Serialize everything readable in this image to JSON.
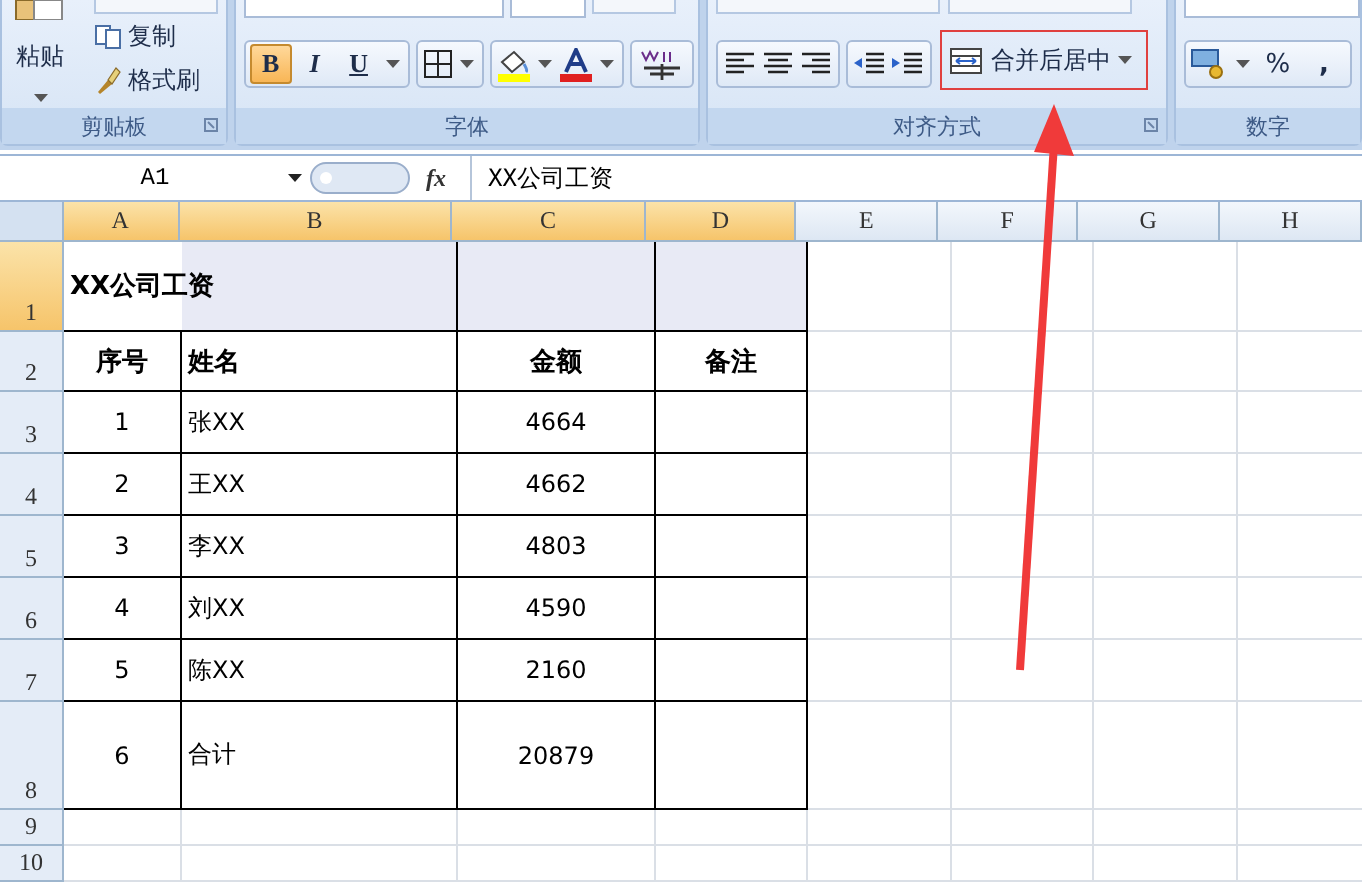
{
  "ribbon": {
    "clipboard": {
      "paste": "粘贴",
      "copy": "复制",
      "format_painter": "格式刷",
      "label": "剪贴板"
    },
    "font": {
      "label": "字体",
      "styles": [
        {
          "label": "B",
          "selected": true
        },
        {
          "label": "I",
          "selected": false
        },
        {
          "label": "U",
          "selected": false
        }
      ]
    },
    "alignment": {
      "label": "对齐方式",
      "merge": {
        "label": "合并后居中",
        "highlighted": true
      }
    },
    "number": {
      "label": "数字",
      "percent": "%",
      "comma": ","
    }
  },
  "formula_bar": {
    "name_box": "A1",
    "fx": "fx",
    "content": "XX公司工资"
  },
  "sheet": {
    "columns": [
      {
        "label": "A",
        "selected": true
      },
      {
        "label": "B",
        "selected": true
      },
      {
        "label": "C",
        "selected": true
      },
      {
        "label": "D",
        "selected": true
      },
      {
        "label": "E",
        "selected": false
      },
      {
        "label": "F",
        "selected": false
      },
      {
        "label": "G",
        "selected": false
      },
      {
        "label": "H",
        "selected": false
      }
    ],
    "rows": [
      {
        "label": "1",
        "kind": "title",
        "selected": true,
        "cells": [
          {
            "text": "XX公司工资",
            "selected": true,
            "active": true
          },
          {
            "selected": true
          },
          {
            "selected": true
          }
        ]
      },
      {
        "label": "2",
        "kind": "header",
        "selected": false,
        "cells": [
          {
            "text": "序号"
          },
          {
            "text": "姓名"
          },
          {
            "text": "金额"
          },
          {
            "text": "备注"
          }
        ]
      },
      {
        "label": "3",
        "kind": "data",
        "selected": false,
        "cells": [
          {
            "text": "1"
          },
          {
            "text": "张XX"
          },
          {
            "text": "4664"
          },
          {}
        ]
      },
      {
        "label": "4",
        "kind": "data",
        "selected": false,
        "cells": [
          {
            "text": "2"
          },
          {
            "text": "王XX"
          },
          {
            "text": "4662"
          },
          {}
        ]
      },
      {
        "label": "5",
        "kind": "data",
        "selected": false,
        "cells": [
          {
            "text": "3"
          },
          {
            "text": "李XX"
          },
          {
            "text": "4803"
          },
          {}
        ]
      },
      {
        "label": "6",
        "kind": "data",
        "selected": false,
        "cells": [
          {
            "text": "4"
          },
          {
            "text": "刘XX"
          },
          {
            "text": "4590"
          },
          {}
        ]
      },
      {
        "label": "7",
        "kind": "data",
        "selected": false,
        "cells": [
          {
            "text": "5"
          },
          {
            "text": "陈XX"
          },
          {
            "text": "2160"
          },
          {}
        ]
      },
      {
        "label": "8",
        "kind": "total",
        "selected": false,
        "cells": [
          {
            "text": "6"
          },
          {
            "text": "合计"
          },
          {
            "text": "20879"
          },
          {}
        ]
      },
      {
        "label": "9",
        "kind": "empty",
        "selected": false,
        "cells": []
      },
      {
        "label": "10",
        "kind": "empty",
        "selected": false,
        "cells": []
      }
    ]
  }
}
